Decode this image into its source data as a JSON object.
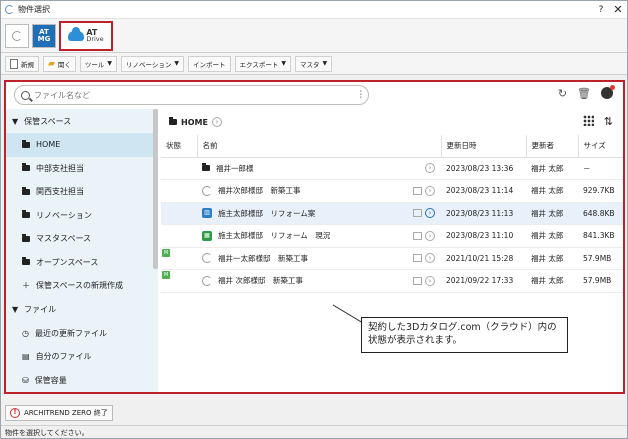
{
  "window": {
    "title": "物件選択",
    "help": "?",
    "close": "✕"
  },
  "app_tabs": {
    "atmg_line1": "AT",
    "atmg_line2": "MG",
    "atdrive_line1": "AT",
    "atdrive_line2": "Drive"
  },
  "toolbar": {
    "new_label": "新規",
    "import_label": "関く",
    "tool_label": "ツール",
    "renovation_label": "リノベーション",
    "import2_label": "インポート",
    "export_label": "エクスポート",
    "master_label": "マスタ"
  },
  "search": {
    "placeholder": "ファイル名など"
  },
  "sidebar": {
    "storage_section": "保管スペース",
    "items": [
      {
        "label": "HOME"
      },
      {
        "label": "中部支社担当"
      },
      {
        "label": "関西支社担当"
      },
      {
        "label": "リノベーション"
      },
      {
        "label": "マスタスペース"
      },
      {
        "label": "オープンスペース"
      }
    ],
    "new_space": "保管スペースの新規作成",
    "file_section": "ファイル",
    "recent": "最近の更新ファイル",
    "mine": "自分のファイル",
    "capacity": "保管容量"
  },
  "main": {
    "breadcrumb": "HOME",
    "columns": {
      "status": "状態",
      "name": "名前",
      "updated": "更新日時",
      "updater": "更新者",
      "size": "サイズ"
    },
    "rows": [
      {
        "name": "福井一郎様",
        "updated": "2023/08/23 13:36",
        "updater": "福井 太郎",
        "size": "－"
      },
      {
        "name": "福井次郎様邸　新築工事",
        "updated": "2023/08/23 11:14",
        "updater": "福井 太郎",
        "size": "929.7KB"
      },
      {
        "name": "施主太郎様邸　リフォーム案",
        "updated": "2023/08/23 11:13",
        "updater": "福井 太郎",
        "size": "648.8KB"
      },
      {
        "name": "施主太郎様邸　リフォーム　現況",
        "updated": "2023/08/23 11:10",
        "updater": "福井 太郎",
        "size": "841.3KB"
      },
      {
        "name": "福井一太郎様邸　新築工事",
        "updated": "2021/10/21 15:28",
        "updater": "福井 太郎",
        "size": "57.9MB"
      },
      {
        "name": "福井 次郎様邸　新築工事",
        "updated": "2021/09/22 17:33",
        "updater": "福井 太郎",
        "size": "57.9MB"
      }
    ]
  },
  "callout": {
    "text": "契約した3Dカタログ.com（クラウド）内の状態が表示されます。"
  },
  "bottom": {
    "exit_label": "ARCHITREND ZERO 終了",
    "status": "物件を選択してください。"
  },
  "colors": {
    "accent_red": "#c0202a",
    "accent_blue": "#1f6fb8"
  }
}
